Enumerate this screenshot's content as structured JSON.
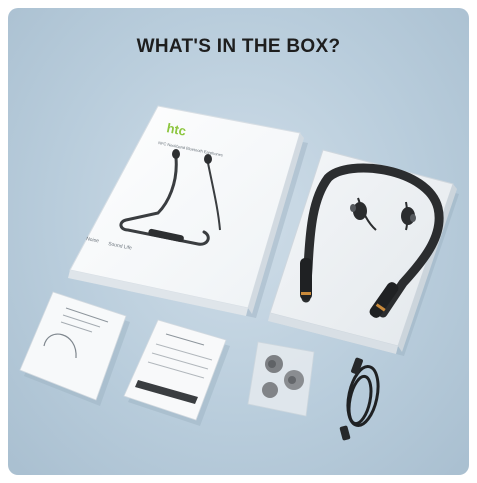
{
  "heading": "WHAT'S IN THE BOX?",
  "box": {
    "brand": "htc",
    "tagline": "NFC Neckband Bluetooth Earphones",
    "feature_left": "Noise",
    "feature_right": "Sound Life"
  },
  "items": [
    {
      "name": "retail-box"
    },
    {
      "name": "neckband-earphones-in-tray"
    },
    {
      "name": "user-manual"
    },
    {
      "name": "warranty-card"
    },
    {
      "name": "spare-ear-tips"
    },
    {
      "name": "usb-charging-cable"
    }
  ],
  "colors": {
    "background": "#b9cddc",
    "brand_accent": "#8dc63f",
    "heading": "#1e1e1e"
  }
}
